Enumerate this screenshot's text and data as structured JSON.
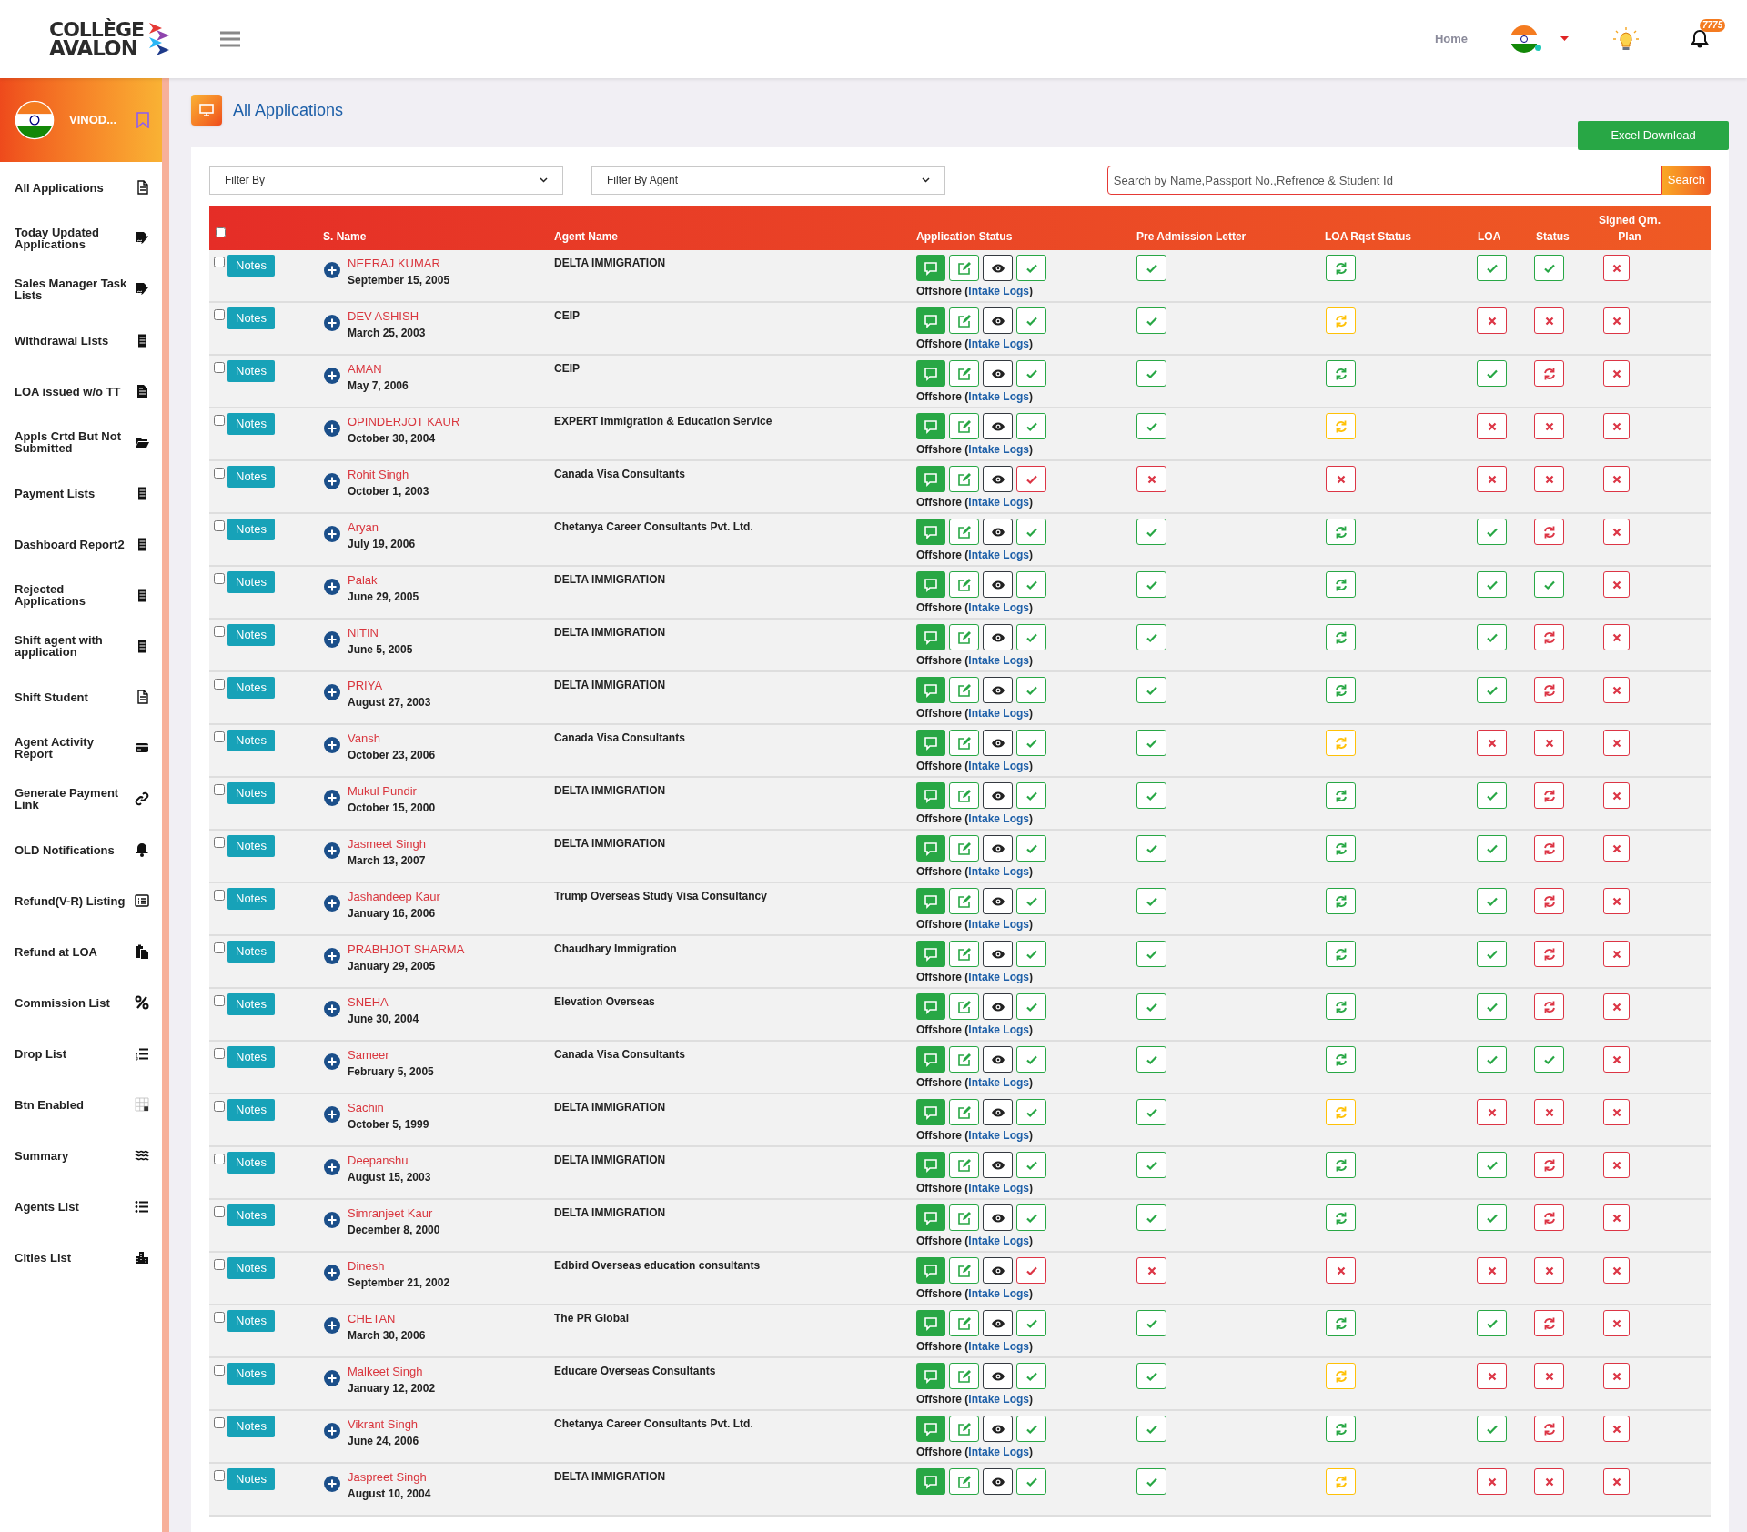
{
  "topbar": {
    "logo_line1": "COLLÈGE",
    "logo_line2": "AVALON",
    "home_link": "Home",
    "notification_count": "7775",
    "user_online": true
  },
  "sidebar": {
    "user_name": "VINOD...",
    "items": [
      {
        "label": "All Applications",
        "kind": "file"
      },
      {
        "label": "Today Updated Applications",
        "kind": "signature"
      },
      {
        "label": "Sales Manager Task Lists",
        "kind": "signature"
      },
      {
        "label": "Withdrawal Lists",
        "kind": "receipt"
      },
      {
        "label": "LOA issued w/o TT",
        "kind": "file-filled"
      },
      {
        "label": "Appls Crtd But Not Submitted",
        "kind": "folder"
      },
      {
        "label": "Payment Lists",
        "kind": "receipt"
      },
      {
        "label": "Dashboard Report2",
        "kind": "receipt"
      },
      {
        "label": "Rejected Applications",
        "kind": "receipt"
      },
      {
        "label": "Shift agent with application",
        "kind": "receipt"
      },
      {
        "label": "Shift Student",
        "kind": "file"
      },
      {
        "label": "Agent Activity Report",
        "kind": "card"
      },
      {
        "label": "Generate Payment Link",
        "kind": "link"
      },
      {
        "label": "OLD Notifications",
        "kind": "bell"
      },
      {
        "label": "Refund(V-R) Listing",
        "kind": "list-box"
      },
      {
        "label": "Refund at LOA",
        "kind": "paste"
      },
      {
        "label": "Commission List",
        "kind": "percent"
      },
      {
        "label": "Drop List",
        "kind": "list-ol"
      },
      {
        "label": "Btn Enabled",
        "kind": "grid"
      },
      {
        "label": "Summary",
        "kind": "waves"
      },
      {
        "label": "Agents List",
        "kind": "list-ul"
      },
      {
        "label": "Cities List",
        "kind": "city"
      }
    ]
  },
  "page": {
    "title": "All Applications",
    "excel_button": "Excel Download"
  },
  "filters": {
    "filter_by": "Filter By",
    "filter_by_agent": "Filter By Agent",
    "search_placeholder": "Search by Name,Passport No.,Refrence & Student Id",
    "search_button": "Search"
  },
  "table": {
    "select_all": {
      "checked": false
    },
    "columns": [
      "S. Name",
      "Agent Name",
      "Application Status",
      "Pre Admission Letter",
      "LOA Rqst Status",
      "LOA",
      "Status",
      "Signed Qrn. Plan"
    ],
    "rows": [
      {
        "checked": false,
        "notes": "Notes",
        "name": "NEERAJ KUMAR",
        "dob": "September 15, 2005",
        "agent": "DELTA IMMIGRATION",
        "app_check": {
          "kind": "approved"
        },
        "location": "Offshore (",
        "logs_link": "Intake Logs",
        "closing": ")",
        "pal": {
          "kind": "approved"
        },
        "loa_rqst": {
          "kind": "processing"
        },
        "loa": {
          "kind": "approved"
        },
        "status": {
          "kind": "approved"
        },
        "signed": {
          "kind": "rejected"
        }
      },
      {
        "checked": false,
        "notes": "Notes",
        "name": "DEV ASHISH",
        "dob": "March 25, 2003",
        "agent": "CEIP",
        "app_check": {
          "kind": "approved"
        },
        "location": "Offshore (",
        "logs_link": "Intake Logs",
        "closing": ")",
        "pal": {
          "kind": "approved"
        },
        "loa_rqst": {
          "kind": "pending"
        },
        "loa": {
          "kind": "rejected"
        },
        "status": {
          "kind": "rejected"
        },
        "signed": {
          "kind": "rejected"
        }
      },
      {
        "checked": false,
        "notes": "Notes",
        "name": "AMAN",
        "dob": "May 7, 2006",
        "agent": "CEIP",
        "app_check": {
          "kind": "approved"
        },
        "location": "Offshore (",
        "logs_link": "Intake Logs",
        "closing": ")",
        "pal": {
          "kind": "approved"
        },
        "loa_rqst": {
          "kind": "processing"
        },
        "loa": {
          "kind": "approved"
        },
        "status": {
          "kind": "on_hold"
        },
        "signed": {
          "kind": "rejected"
        }
      },
      {
        "checked": false,
        "notes": "Notes",
        "name": "OPINDERJOT KAUR",
        "dob": "October 30, 2004",
        "agent": "EXPERT Immigration & Education Service",
        "app_check": {
          "kind": "approved"
        },
        "location": "Offshore (",
        "logs_link": "Intake Logs",
        "closing": ")",
        "pal": {
          "kind": "approved"
        },
        "loa_rqst": {
          "kind": "pending"
        },
        "loa": {
          "kind": "rejected"
        },
        "status": {
          "kind": "rejected"
        },
        "signed": {
          "kind": "rejected"
        }
      },
      {
        "checked": false,
        "notes": "Notes",
        "name": "Rohit Singh",
        "dob": "October 1, 2003",
        "agent": "Canada Visa Consultants",
        "app_check": {
          "kind": "flagged"
        },
        "location": "Offshore (",
        "logs_link": "Intake Logs",
        "closing": ")",
        "pal": {
          "kind": "rejected"
        },
        "loa_rqst": {
          "kind": "rejected"
        },
        "loa": {
          "kind": "rejected"
        },
        "status": {
          "kind": "rejected"
        },
        "signed": {
          "kind": "rejected"
        }
      },
      {
        "checked": false,
        "notes": "Notes",
        "name": "Aryan",
        "dob": "July 19, 2006",
        "agent": "Chetanya Career Consultants Pvt. Ltd.",
        "app_check": {
          "kind": "approved"
        },
        "location": "Offshore (",
        "logs_link": "Intake Logs",
        "closing": ")",
        "pal": {
          "kind": "approved"
        },
        "loa_rqst": {
          "kind": "processing"
        },
        "loa": {
          "kind": "approved"
        },
        "status": {
          "kind": "on_hold"
        },
        "signed": {
          "kind": "rejected"
        }
      },
      {
        "checked": false,
        "notes": "Notes",
        "name": "Palak",
        "dob": "June 29, 2005",
        "agent": "DELTA IMMIGRATION",
        "app_check": {
          "kind": "approved"
        },
        "location": "Offshore (",
        "logs_link": "Intake Logs",
        "closing": ")",
        "pal": {
          "kind": "approved"
        },
        "loa_rqst": {
          "kind": "processing"
        },
        "loa": {
          "kind": "approved"
        },
        "status": {
          "kind": "approved"
        },
        "signed": {
          "kind": "rejected"
        }
      },
      {
        "checked": false,
        "notes": "Notes",
        "name": "NITIN",
        "dob": "June 5, 2005",
        "agent": "DELTA IMMIGRATION",
        "app_check": {
          "kind": "approved"
        },
        "location": "Offshore (",
        "logs_link": "Intake Logs",
        "closing": ")",
        "pal": {
          "kind": "approved"
        },
        "loa_rqst": {
          "kind": "processing"
        },
        "loa": {
          "kind": "approved"
        },
        "status": {
          "kind": "on_hold"
        },
        "signed": {
          "kind": "rejected"
        }
      },
      {
        "checked": false,
        "notes": "Notes",
        "name": "PRIYA",
        "dob": "August 27, 2003",
        "agent": "DELTA IMMIGRATION",
        "app_check": {
          "kind": "approved"
        },
        "location": "Offshore (",
        "logs_link": "Intake Logs",
        "closing": ")",
        "pal": {
          "kind": "approved"
        },
        "loa_rqst": {
          "kind": "processing"
        },
        "loa": {
          "kind": "approved"
        },
        "status": {
          "kind": "on_hold"
        },
        "signed": {
          "kind": "rejected"
        }
      },
      {
        "checked": false,
        "notes": "Notes",
        "name": "Vansh",
        "dob": "October 23, 2006",
        "agent": "Canada Visa Consultants",
        "app_check": {
          "kind": "approved"
        },
        "location": "Offshore (",
        "logs_link": "Intake Logs",
        "closing": ")",
        "pal": {
          "kind": "approved"
        },
        "loa_rqst": {
          "kind": "pending"
        },
        "loa": {
          "kind": "rejected"
        },
        "status": {
          "kind": "rejected"
        },
        "signed": {
          "kind": "rejected"
        }
      },
      {
        "checked": false,
        "notes": "Notes",
        "name": "Mukul Pundir",
        "dob": "October 15, 2000",
        "agent": "DELTA IMMIGRATION",
        "app_check": {
          "kind": "approved"
        },
        "location": "Offshore (",
        "logs_link": "Intake Logs",
        "closing": ")",
        "pal": {
          "kind": "approved"
        },
        "loa_rqst": {
          "kind": "processing"
        },
        "loa": {
          "kind": "approved"
        },
        "status": {
          "kind": "on_hold"
        },
        "signed": {
          "kind": "rejected"
        }
      },
      {
        "checked": false,
        "notes": "Notes",
        "name": "Jasmeet Singh",
        "dob": "March 13, 2007",
        "agent": "DELTA IMMIGRATION",
        "app_check": {
          "kind": "approved"
        },
        "location": "Offshore (",
        "logs_link": "Intake Logs",
        "closing": ")",
        "pal": {
          "kind": "approved"
        },
        "loa_rqst": {
          "kind": "processing"
        },
        "loa": {
          "kind": "approved"
        },
        "status": {
          "kind": "on_hold"
        },
        "signed": {
          "kind": "rejected"
        }
      },
      {
        "checked": false,
        "notes": "Notes",
        "name": "Jashandeep Kaur",
        "dob": "January 16, 2006",
        "agent": "Trump Overseas Study Visa Consultancy",
        "app_check": {
          "kind": "approved"
        },
        "location": "Offshore (",
        "logs_link": "Intake Logs",
        "closing": ")",
        "pal": {
          "kind": "approved"
        },
        "loa_rqst": {
          "kind": "processing"
        },
        "loa": {
          "kind": "approved"
        },
        "status": {
          "kind": "on_hold"
        },
        "signed": {
          "kind": "rejected"
        }
      },
      {
        "checked": false,
        "notes": "Notes",
        "name": "PRABHJOT SHARMA",
        "dob": "January 29, 2005",
        "agent": "Chaudhary Immigration",
        "app_check": {
          "kind": "approved"
        },
        "location": "Offshore (",
        "logs_link": "Intake Logs",
        "closing": ")",
        "pal": {
          "kind": "approved"
        },
        "loa_rqst": {
          "kind": "processing"
        },
        "loa": {
          "kind": "approved"
        },
        "status": {
          "kind": "on_hold"
        },
        "signed": {
          "kind": "rejected"
        }
      },
      {
        "checked": false,
        "notes": "Notes",
        "name": "SNEHA",
        "dob": "June 30, 2004",
        "agent": "Elevation Overseas",
        "app_check": {
          "kind": "approved"
        },
        "location": "Offshore (",
        "logs_link": "Intake Logs",
        "closing": ")",
        "pal": {
          "kind": "approved"
        },
        "loa_rqst": {
          "kind": "processing"
        },
        "loa": {
          "kind": "approved"
        },
        "status": {
          "kind": "on_hold"
        },
        "signed": {
          "kind": "rejected"
        }
      },
      {
        "checked": false,
        "notes": "Notes",
        "name": "Sameer",
        "dob": "February 5, 2005",
        "agent": "Canada Visa Consultants",
        "app_check": {
          "kind": "approved"
        },
        "location": "Offshore (",
        "logs_link": "Intake Logs",
        "closing": ")",
        "pal": {
          "kind": "approved"
        },
        "loa_rqst": {
          "kind": "processing"
        },
        "loa": {
          "kind": "approved"
        },
        "status": {
          "kind": "approved"
        },
        "signed": {
          "kind": "rejected"
        }
      },
      {
        "checked": false,
        "notes": "Notes",
        "name": "Sachin",
        "dob": "October 5, 1999",
        "agent": "DELTA IMMIGRATION",
        "app_check": {
          "kind": "approved"
        },
        "location": "Offshore (",
        "logs_link": "Intake Logs",
        "closing": ")",
        "pal": {
          "kind": "approved"
        },
        "loa_rqst": {
          "kind": "pending"
        },
        "loa": {
          "kind": "rejected"
        },
        "status": {
          "kind": "rejected"
        },
        "signed": {
          "kind": "rejected"
        }
      },
      {
        "checked": false,
        "notes": "Notes",
        "name": "Deepanshu",
        "dob": "August 15, 2003",
        "agent": "DELTA IMMIGRATION",
        "app_check": {
          "kind": "approved"
        },
        "location": "Offshore (",
        "logs_link": "Intake Logs",
        "closing": ")",
        "pal": {
          "kind": "approved"
        },
        "loa_rqst": {
          "kind": "processing"
        },
        "loa": {
          "kind": "approved"
        },
        "status": {
          "kind": "on_hold"
        },
        "signed": {
          "kind": "rejected"
        }
      },
      {
        "checked": false,
        "notes": "Notes",
        "name": "Simranjeet Kaur",
        "dob": "December 8, 2000",
        "agent": "DELTA IMMIGRATION",
        "app_check": {
          "kind": "approved"
        },
        "location": "Offshore (",
        "logs_link": "Intake Logs",
        "closing": ")",
        "pal": {
          "kind": "approved"
        },
        "loa_rqst": {
          "kind": "processing"
        },
        "loa": {
          "kind": "approved"
        },
        "status": {
          "kind": "on_hold"
        },
        "signed": {
          "kind": "rejected"
        }
      },
      {
        "checked": false,
        "notes": "Notes",
        "name": "Dinesh",
        "dob": "September 21, 2002",
        "agent": "Edbird Overseas education consultants",
        "app_check": {
          "kind": "flagged"
        },
        "location": "Offshore (",
        "logs_link": "Intake Logs",
        "closing": ")",
        "pal": {
          "kind": "rejected"
        },
        "loa_rqst": {
          "kind": "rejected"
        },
        "loa": {
          "kind": "rejected"
        },
        "status": {
          "kind": "rejected"
        },
        "signed": {
          "kind": "rejected"
        }
      },
      {
        "checked": false,
        "notes": "Notes",
        "name": "CHETAN",
        "dob": "March 30, 2006",
        "agent": "The PR Global",
        "app_check": {
          "kind": "approved"
        },
        "location": "Offshore (",
        "logs_link": "Intake Logs",
        "closing": ")",
        "pal": {
          "kind": "approved"
        },
        "loa_rqst": {
          "kind": "processing"
        },
        "loa": {
          "kind": "approved"
        },
        "status": {
          "kind": "on_hold"
        },
        "signed": {
          "kind": "rejected"
        }
      },
      {
        "checked": false,
        "notes": "Notes",
        "name": "Malkeet Singh",
        "dob": "January 12, 2002",
        "agent": "Educare Overseas Consultants",
        "app_check": {
          "kind": "approved"
        },
        "location": "Offshore (",
        "logs_link": "Intake Logs",
        "closing": ")",
        "pal": {
          "kind": "approved"
        },
        "loa_rqst": {
          "kind": "pending"
        },
        "loa": {
          "kind": "rejected"
        },
        "status": {
          "kind": "rejected"
        },
        "signed": {
          "kind": "rejected"
        }
      },
      {
        "checked": false,
        "notes": "Notes",
        "name": "Vikrant Singh",
        "dob": "June 24, 2006",
        "agent": "Chetanya Career Consultants Pvt. Ltd.",
        "app_check": {
          "kind": "approved"
        },
        "location": "Offshore (",
        "logs_link": "Intake Logs",
        "closing": ")",
        "pal": {
          "kind": "approved"
        },
        "loa_rqst": {
          "kind": "processing"
        },
        "loa": {
          "kind": "approved"
        },
        "status": {
          "kind": "on_hold"
        },
        "signed": {
          "kind": "rejected"
        }
      },
      {
        "checked": false,
        "notes": "Notes",
        "name": "Jaspreet Singh",
        "dob": "August 10, 2004",
        "agent": "DELTA IMMIGRATION",
        "app_check": {
          "kind": "approved"
        },
        "pal": {
          "kind": "approved"
        },
        "loa_rqst": {
          "kind": "pending"
        },
        "loa": {
          "kind": "rejected"
        },
        "status": {
          "kind": "rejected"
        },
        "signed": {
          "kind": "rejected"
        }
      }
    ]
  }
}
